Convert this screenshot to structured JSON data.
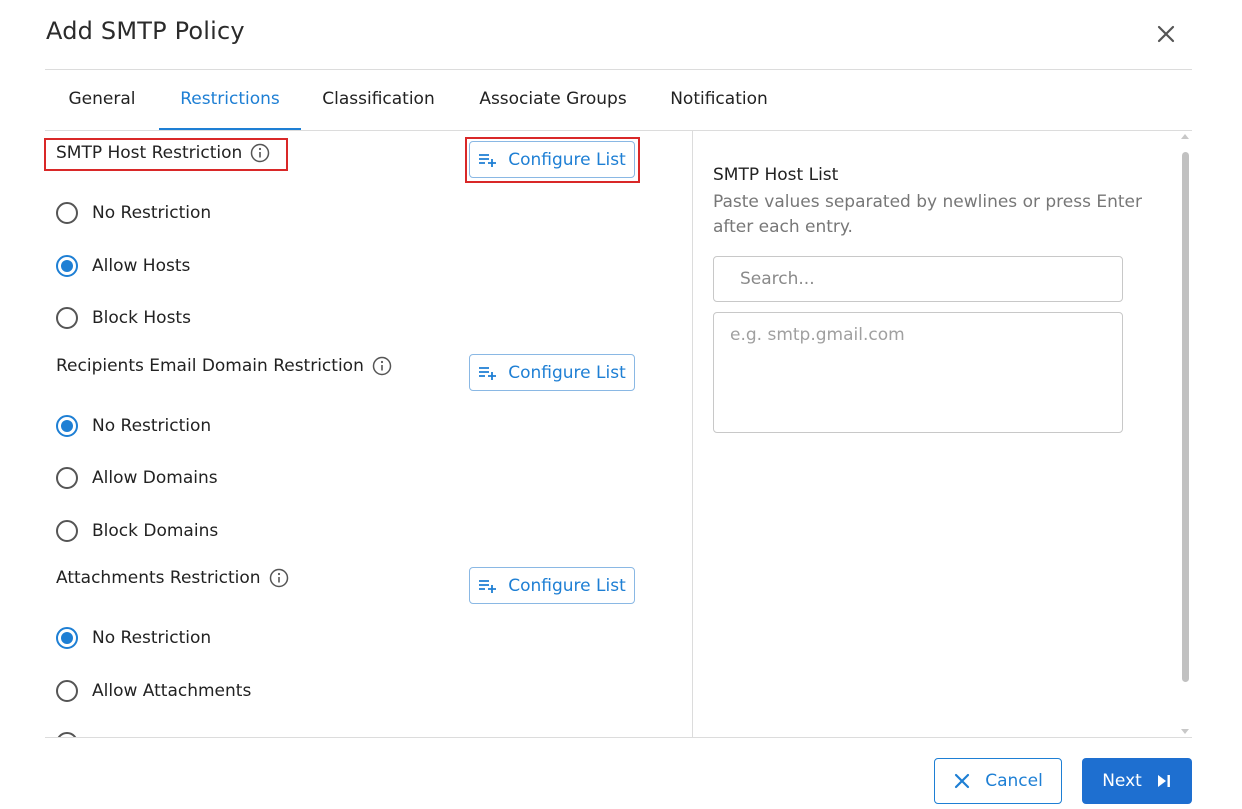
{
  "dialog": {
    "title": "Add SMTP Policy"
  },
  "tabs": [
    {
      "label": "General"
    },
    {
      "label": "Restrictions",
      "active": true
    },
    {
      "label": "Classification"
    },
    {
      "label": "Associate Groups"
    },
    {
      "label": "Notification"
    }
  ],
  "sections": [
    {
      "label": "SMTP Host Restriction",
      "configure_label": "Configure List",
      "options": [
        {
          "label": "No Restriction",
          "checked": false
        },
        {
          "label": "Allow Hosts",
          "checked": true
        },
        {
          "label": "Block Hosts",
          "checked": false
        }
      ]
    },
    {
      "label": "Recipients Email Domain Restriction",
      "configure_label": "Configure List",
      "options": [
        {
          "label": "No Restriction",
          "checked": true
        },
        {
          "label": "Allow Domains",
          "checked": false
        },
        {
          "label": "Block Domains",
          "checked": false
        }
      ]
    },
    {
      "label": "Attachments Restriction",
      "configure_label": "Configure List",
      "options": [
        {
          "label": "No Restriction",
          "checked": true
        },
        {
          "label": "Allow Attachments",
          "checked": false
        }
      ]
    }
  ],
  "right_panel": {
    "title": "SMTP Host List",
    "help": "Paste values separated by newlines or press Enter after each entry.",
    "search_placeholder": "Search...",
    "textarea_placeholder": "e.g. smtp.gmail.com"
  },
  "footer": {
    "cancel_label": "Cancel",
    "next_label": "Next"
  },
  "colors": {
    "accent": "#1e7fd4",
    "highlight": "#d92828",
    "primary_button": "#1e6fd0"
  }
}
